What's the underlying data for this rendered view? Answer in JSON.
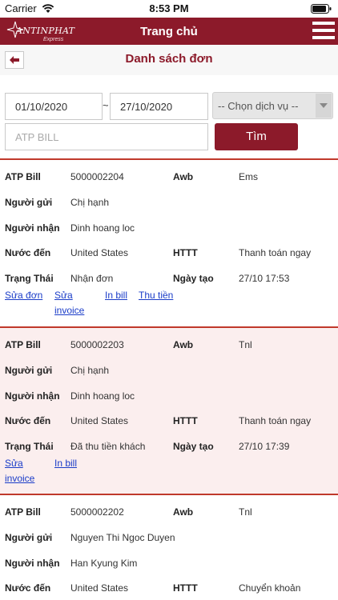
{
  "status_bar": {
    "carrier": "Carrier",
    "time": "8:53 PM"
  },
  "header": {
    "title": "Trang chủ",
    "logo_text": "ANTINPHAT",
    "logo_sub": "Express"
  },
  "subheader": {
    "title": "Danh sách đơn"
  },
  "filter": {
    "date_from": "01/10/2020",
    "date_separator": "~",
    "date_to": "27/10/2020",
    "service_placeholder": "-- Chọn dịch vụ --",
    "bill_placeholder": "ATP BILL",
    "search_label": "Tìm"
  },
  "labels": {
    "atp_bill": "ATP Bill",
    "awb": "Awb",
    "sender": "Người gửi",
    "receiver": "Người nhận",
    "destination": "Nước đến",
    "httt": "HTTT",
    "status": "Trạng Thái",
    "created": "Ngày tạo"
  },
  "actions": {
    "edit_order": "Sửa đơn",
    "edit_invoice_1": "Sửa",
    "edit_invoice_2": "invoice",
    "print_bill": "In bill",
    "collect": "Thu tiền"
  },
  "orders": [
    {
      "atp_bill": "5000002204",
      "awb": "Ems",
      "sender": "Chị hạnh",
      "receiver": "Dinh hoang loc",
      "destination": "United States",
      "httt": "Thanh toán ngay",
      "status": "Nhận đơn",
      "created": "27/10 17:53"
    },
    {
      "atp_bill": "5000002203",
      "awb": "Tnl",
      "sender": "Chị hạnh",
      "receiver": "Dinh hoang loc",
      "destination": "United States",
      "httt": "Thanh toán ngay",
      "status": "Đã thu tiền khách",
      "created": "27/10 17:39"
    },
    {
      "atp_bill": "5000002202",
      "awb": "Tnl",
      "sender": "Nguyen Thi Ngoc Duyen",
      "receiver": "Han Kyung Kim",
      "destination": "United States",
      "httt": "Chuyển khoản"
    }
  ],
  "colors": {
    "brand": "#8c1a2a",
    "card_divider": "#c0392b",
    "link": "#1a3cc8",
    "alt_row": "#fbeeee"
  }
}
